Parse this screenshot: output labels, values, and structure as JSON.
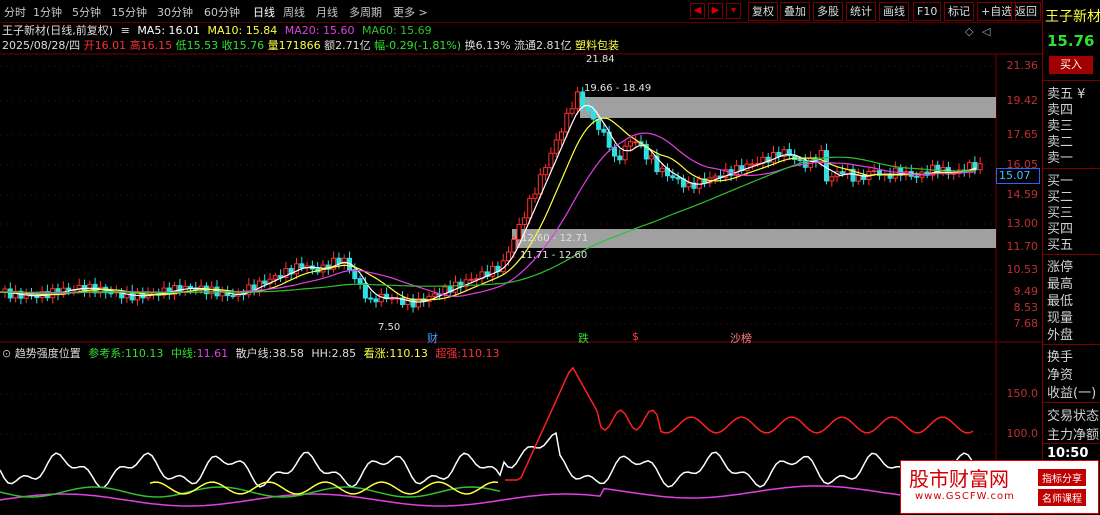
{
  "tabs": [
    "分时",
    "1分钟",
    "5分钟",
    "15分钟",
    "30分钟",
    "60分钟",
    "日线",
    "周线",
    "月线",
    "多周期",
    "更多 >"
  ],
  "toolbar": [
    "复权",
    "叠加",
    "多股",
    "统计",
    "画线",
    "F10",
    "标记",
    "+自选",
    "返回"
  ],
  "header": {
    "title": "王子新材(日线,前复权)",
    "ma5": "MA5: 16.01",
    "ma10": "MA10: 15.84",
    "ma20": "MA20: 15.60",
    "ma60": "MA60: 15.69",
    "date": "2025/08/28/四",
    "open": "开16.01",
    "high": "高16.15",
    "low": "低15.53",
    "close": "收15.76",
    "vol": "量171866",
    "amount": "额2.71亿",
    "chg": "幅-0.29(-1.81%)",
    "turnover": "换6.13%",
    "float": "流通2.81亿",
    "sector": "塑料包装"
  },
  "price_axis": [
    "21.36",
    "19.42",
    "17.65",
    "16.05",
    "14.59",
    "13.00",
    "11.70",
    "10.53",
    "9.49",
    "8.53",
    "7.68"
  ],
  "current_price_tag": "15.07",
  "annotations": {
    "high_mark": "21.84",
    "low_mark": "7.50",
    "box_upper": "19.66 - 18.49",
    "box_lower_a": "12.60 - 12.71",
    "box_lower_b": "11.71 - 12.60",
    "events": [
      "财",
      "跌",
      "$",
      "沙榜"
    ]
  },
  "indicator": {
    "name": "趋势强度位置",
    "ref_label": "参考系:",
    "ref_val": "110.13",
    "mid_label": "中线:",
    "mid_val": "11.61",
    "retail_label": "散户线:",
    "retail_val": "38.58",
    "hh_label": "HH:",
    "hh_val": "2.85",
    "bull_label": "看涨:",
    "bull_val": "110.13",
    "strong_label": "超强:",
    "strong_val": "110.13",
    "axis": [
      "150.0",
      "100.0"
    ]
  },
  "right_panel": {
    "name": "王子新材",
    "price": "15.76",
    "buy_btn": "买入",
    "sell": [
      "卖五 ¥",
      "卖四",
      "卖三",
      "卖二",
      "卖一"
    ],
    "buy": [
      "买一",
      "买二",
      "买三",
      "买四",
      "买五"
    ],
    "stats": [
      "涨停",
      "最高",
      "最低",
      "现量",
      "外盘"
    ],
    "stats2": [
      "换手",
      "净资",
      "收益(一)"
    ],
    "misc": [
      "交易状态",
      "主力净额"
    ],
    "time": "10:50"
  },
  "watermark": {
    "title": "股市财富网",
    "url": "www.GSCFW.com",
    "tag1": "指标分享",
    "tag2": "名师课程"
  },
  "colors": {
    "up": "#ff3030",
    "down": "#30e0e0",
    "ma5": "#ffffff",
    "ma10": "#ffff40",
    "ma20": "#e040e0",
    "ma60": "#30c030"
  }
}
